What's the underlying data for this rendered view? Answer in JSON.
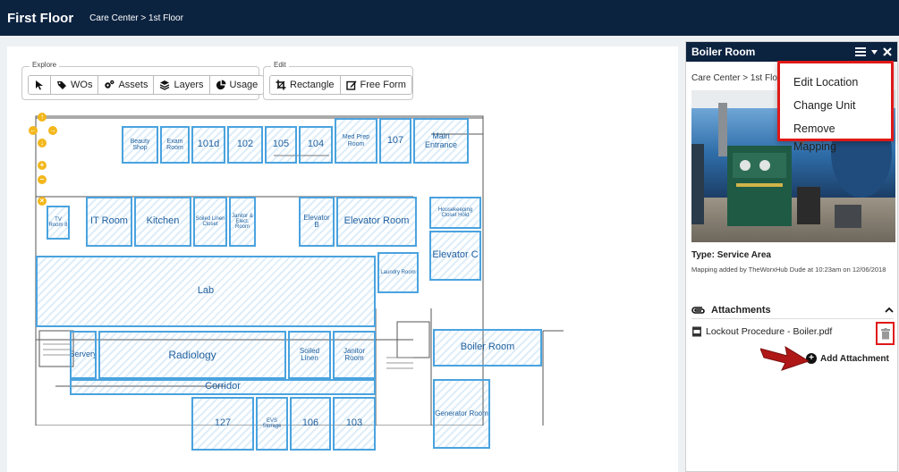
{
  "header": {
    "title": "First Floor",
    "breadcrumb": "Care Center > 1st Floor"
  },
  "toolbar": {
    "explore_label": "Explore",
    "edit_label": "Edit",
    "explore_buttons": [
      {
        "label": "",
        "icon": "pointer-icon"
      },
      {
        "label": "WOs",
        "icon": "tag-icon"
      },
      {
        "label": "Assets",
        "icon": "cogs-icon"
      },
      {
        "label": "Layers",
        "icon": "layers-icon"
      },
      {
        "label": "Usage",
        "icon": "pie-icon"
      }
    ],
    "edit_buttons": [
      {
        "label": "Rectangle",
        "icon": "crop-icon"
      },
      {
        "label": "Free Form",
        "icon": "edit-icon"
      }
    ]
  },
  "rooms": {
    "beauty_shop": "Beauty Shop",
    "exam_room": "Exam Room",
    "r101d": "101d",
    "r102": "102",
    "r105": "105",
    "r104": "104",
    "med_prep": "Med Prep Room",
    "r107": "107",
    "main_entrance": "Main Entrance",
    "tv_room": "TV Room 8",
    "it_room": "IT Room",
    "kitchen": "Kitchen",
    "soiled_linen_small": "Soiled Linen Closet",
    "janitor_small": "Janitor & Elect. Room",
    "elevator_b": "Elevator B",
    "elevator_room": "Elevator Room",
    "housekeeping": "Housekeeping Closet Hold",
    "elevator_c": "Elevator C",
    "laundry": "Laundry Room",
    "lab": "Lab",
    "servery": "Servery",
    "radiology": "Radiology",
    "soiled_linen": "Soiled Linen",
    "janitor_room": "Janitor Room",
    "boiler_room": "Boiler Room",
    "corridor": "Corridor",
    "r127": "127",
    "evs_storage": "EVS Storage",
    "r106": "106",
    "r103": "103",
    "generator_room": "Generator Room"
  },
  "side_panel": {
    "title": "Boiler Room",
    "breadcrumb": "Care Center > 1st Floor",
    "type": "Type: Service Area",
    "meta": "Mapping added by TheWorxHub Dude at 10:23am on 12/06/2018",
    "attachments_label": "Attachments",
    "attachment_file": "Lockout Procedure - Boiler.pdf",
    "add_attachment": "Add Attachment"
  },
  "dropdown": {
    "items": [
      "Edit Location",
      "Change Unit",
      "Remove Mapping"
    ]
  },
  "colors": {
    "header_bg": "#0c2340",
    "room_border": "#4aa3df",
    "highlight": "#e01818",
    "zoom_control": "#f3b71c"
  }
}
